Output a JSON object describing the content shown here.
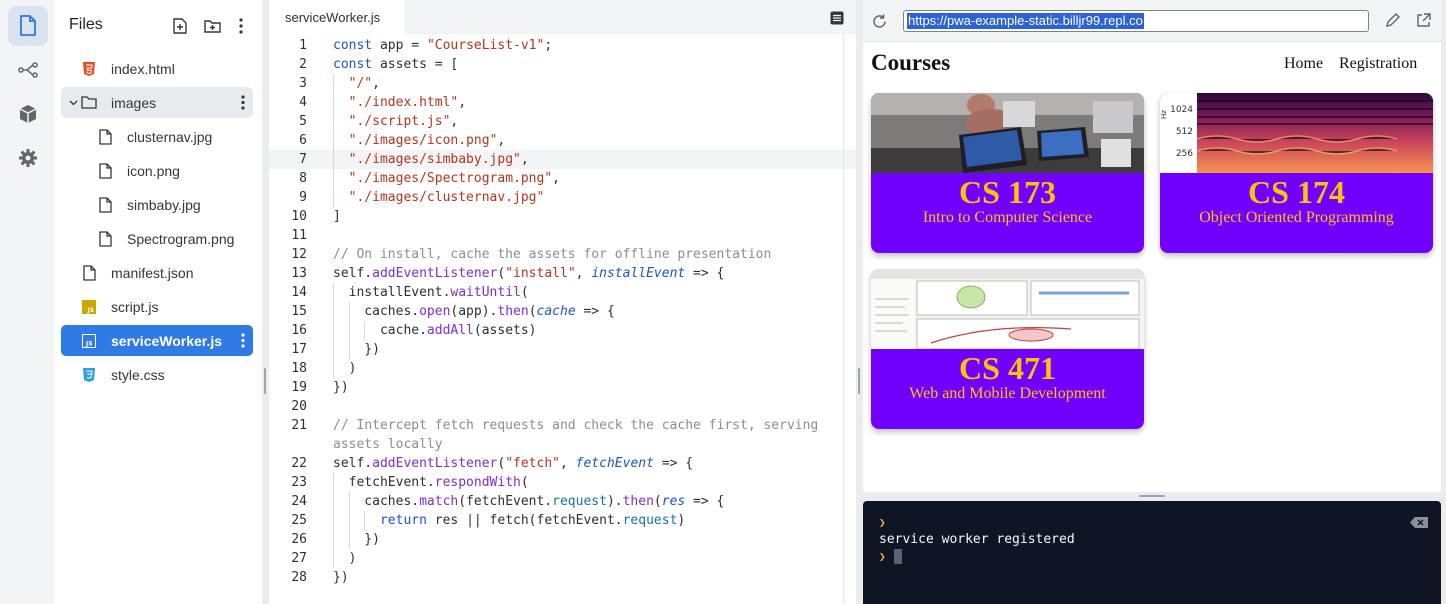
{
  "sidebar_nav": {
    "items": [
      {
        "icon": "file-icon",
        "active": true
      },
      {
        "icon": "git-branch-icon"
      },
      {
        "icon": "package-icon"
      },
      {
        "icon": "gear-icon"
      }
    ]
  },
  "files_panel": {
    "title": "Files",
    "items": [
      {
        "label": "index.html",
        "icon": "html-icon",
        "depth": 0
      },
      {
        "label": "images",
        "icon": "folder-icon",
        "depth": 0,
        "expanded": true
      },
      {
        "label": "clusternav.jpg",
        "icon": "file-icon",
        "depth": 1
      },
      {
        "label": "icon.png",
        "icon": "file-icon",
        "depth": 1
      },
      {
        "label": "simbaby.jpg",
        "icon": "file-icon",
        "depth": 1
      },
      {
        "label": "Spectrogram.png",
        "icon": "file-icon",
        "depth": 1
      },
      {
        "label": "manifest.json",
        "icon": "file-icon",
        "depth": 0
      },
      {
        "label": "script.js",
        "icon": "js-icon",
        "depth": 0
      },
      {
        "label": "serviceWorker.js",
        "icon": "js-icon",
        "depth": 0,
        "active": true
      },
      {
        "label": "style.css",
        "icon": "css-icon",
        "depth": 0
      }
    ]
  },
  "editor": {
    "tab_label": "serviceWorker.js",
    "current_line": 7,
    "lines": [
      {
        "n": "1",
        "text": "const app = \"CourseList-v1\";"
      },
      {
        "n": "2",
        "text": "const assets = ["
      },
      {
        "n": "3",
        "text": "  \"/\","
      },
      {
        "n": "4",
        "text": "  \"./index.html\","
      },
      {
        "n": "5",
        "text": "  \"./script.js\","
      },
      {
        "n": "6",
        "text": "  \"./images/icon.png\","
      },
      {
        "n": "7",
        "text": "  \"./images/simbaby.jpg\","
      },
      {
        "n": "8",
        "text": "  \"./images/Spectrogram.png\","
      },
      {
        "n": "9",
        "text": "  \"./images/clusternav.jpg\""
      },
      {
        "n": "10",
        "text": "]"
      },
      {
        "n": "11",
        "text": ""
      },
      {
        "n": "12",
        "text": "// On install, cache the assets for offline presentation"
      },
      {
        "n": "13",
        "text": "self.addEventListener(\"install\", installEvent => {"
      },
      {
        "n": "14",
        "text": "  installEvent.waitUntil("
      },
      {
        "n": "15",
        "text": "    caches.open(app).then(cache => {"
      },
      {
        "n": "16",
        "text": "      cache.addAll(assets)"
      },
      {
        "n": "17",
        "text": "    })"
      },
      {
        "n": "18",
        "text": "  )"
      },
      {
        "n": "19",
        "text": "})"
      },
      {
        "n": "20",
        "text": ""
      },
      {
        "n": "21",
        "text": "// Intercept fetch requests and check the cache first, serving"
      },
      {
        "n": "",
        "text": "assets locally"
      },
      {
        "n": "22",
        "text": "self.addEventListener(\"fetch\", fetchEvent => {"
      },
      {
        "n": "23",
        "text": "  fetchEvent.respondWith("
      },
      {
        "n": "24",
        "text": "    caches.match(fetchEvent.request).then(res => {"
      },
      {
        "n": "25",
        "text": "      return res || fetch(fetchEvent.request)"
      },
      {
        "n": "26",
        "text": "    })"
      },
      {
        "n": "27",
        "text": "  )"
      },
      {
        "n": "28",
        "text": "})"
      }
    ]
  },
  "webview": {
    "url": "https://pwa-example-static.billjr99.repl.co",
    "site_title": "Courses",
    "nav": [
      "Home",
      "Registration"
    ],
    "courses": [
      {
        "number": "CS 173",
        "name": "Intro to Computer Science",
        "image": "simbaby"
      },
      {
        "number": "CS 174",
        "name": "Object Oriented Programming",
        "image": "spectrogram"
      },
      {
        "number": "CS 471",
        "name": "Web and Mobile Development",
        "image": "clusternav"
      }
    ],
    "spectrogram_axis": {
      "unit": "Hz",
      "ticks": [
        "1024",
        "512",
        "256"
      ]
    }
  },
  "console": {
    "output": "service worker registered"
  },
  "colors": {
    "accent": "#2f7ae5",
    "card_bg": "#7200ff",
    "card_text": "#ffc107",
    "console_bg": "#0e1525"
  }
}
